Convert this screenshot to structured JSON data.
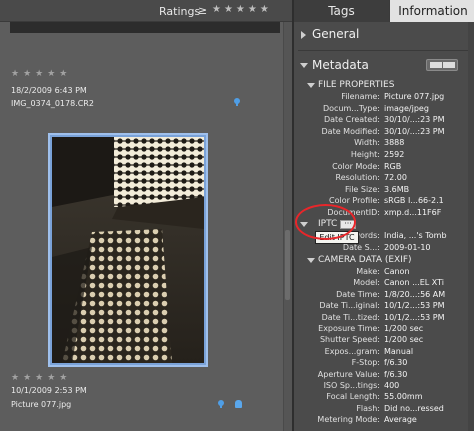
{
  "ratings": {
    "label": "Ratings",
    "operator": "≥",
    "stars": "★★★★★"
  },
  "thumbnails": [
    {
      "stars": "★★★★★",
      "date": "18/2/2009 6:43 PM",
      "name": "IMG_0374_0178.CR2"
    },
    {
      "stars": "★★★★★",
      "date": "10/1/2009 2:53 PM",
      "name": "Picture 077.jpg"
    }
  ],
  "tabs": {
    "tags": "Tags",
    "information": "Information"
  },
  "panel": {
    "general": "General",
    "metadata": "Metadata",
    "file_properties": "FILE PROPERTIES",
    "iptc": "IPTC",
    "iptc_dots": "···",
    "tooltip": "Edit IPTC",
    "camera_data": "CAMERA DATA (EXIF)"
  },
  "file_properties": [
    {
      "k": "Filename:",
      "v": "Picture 077.jpg"
    },
    {
      "k": "Docum...Type:",
      "v": "image/jpeg"
    },
    {
      "k": "Date Created:",
      "v": "30/10/...:23 PM"
    },
    {
      "k": "Date Modified:",
      "v": "30/10/...:23 PM"
    },
    {
      "k": "Width:",
      "v": "3888"
    },
    {
      "k": "Height:",
      "v": "2592"
    },
    {
      "k": "Color Mode:",
      "v": "RGB"
    },
    {
      "k": "Resolution:",
      "v": "72.00"
    },
    {
      "k": "File Size:",
      "v": "3.6MB"
    },
    {
      "k": "Color Profile:",
      "v": "sRGB I...66-2.1"
    },
    {
      "k": "DocumentID:",
      "v": "xmp.d...11F6F"
    }
  ],
  "iptc": [
    {
      "k": "Keywords:",
      "v": "India, ...'s Tomb"
    },
    {
      "k": "Date S...:",
      "v": "2009-01-10"
    }
  ],
  "camera_data": [
    {
      "k": "Make:",
      "v": "Canon"
    },
    {
      "k": "Model:",
      "v": "Canon ...EL XTi"
    },
    {
      "k": "Date Time:",
      "v": "1/8/20...:56 AM"
    },
    {
      "k": "Date Ti...iginal:",
      "v": "10/1/2...:53 PM"
    },
    {
      "k": "Date Ti...tized:",
      "v": "10/1/2...:53 PM"
    },
    {
      "k": "Exposure Time:",
      "v": "1/200 sec"
    },
    {
      "k": "Shutter Speed:",
      "v": "1/200 sec"
    },
    {
      "k": "Expos...gram:",
      "v": "Manual"
    },
    {
      "k": "F-Stop:",
      "v": "f/6.30"
    },
    {
      "k": "Aperture Value:",
      "v": "f/6.30"
    },
    {
      "k": "ISO Sp...tings:",
      "v": "400"
    },
    {
      "k": "Focal Length:",
      "v": "55.00mm"
    },
    {
      "k": "Flash:",
      "v": "Did no...ressed"
    },
    {
      "k": "Metering Mode:",
      "v": "Average"
    }
  ]
}
